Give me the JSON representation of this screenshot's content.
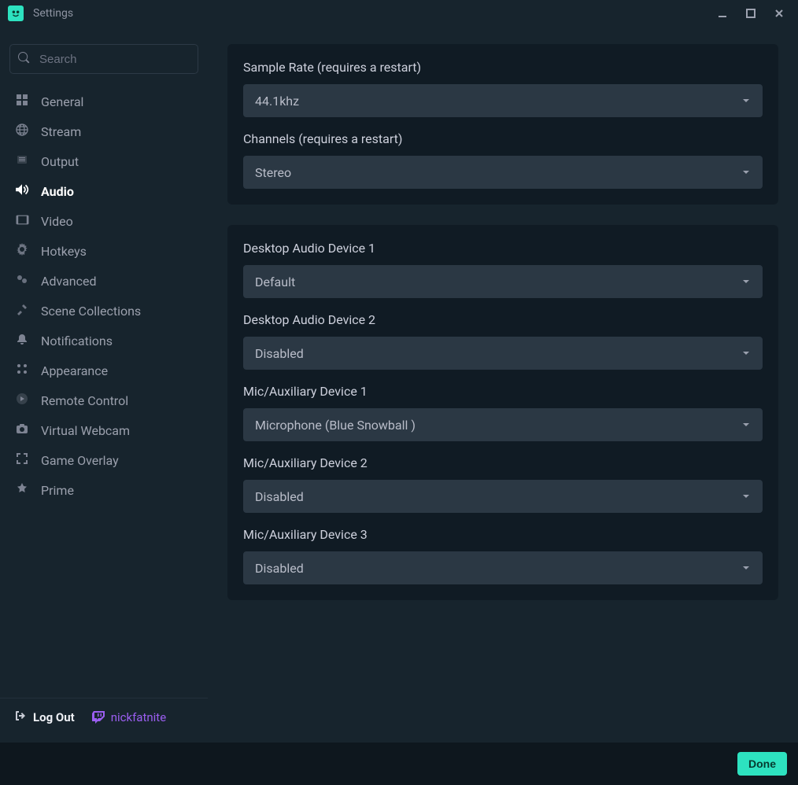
{
  "window": {
    "title": "Settings"
  },
  "sidebar": {
    "search_placeholder": "Search",
    "items": [
      {
        "icon": "⬛",
        "label": "General"
      },
      {
        "icon": "🌐",
        "label": "Stream"
      },
      {
        "icon": "▦",
        "label": "Output"
      },
      {
        "icon": "🔊",
        "label": "Audio",
        "active": true
      },
      {
        "icon": "🎞",
        "label": "Video"
      },
      {
        "icon": "⚙",
        "label": "Hotkeys"
      },
      {
        "icon": "⚙",
        "label": "Advanced"
      },
      {
        "icon": "✂",
        "label": "Scene Collections"
      },
      {
        "icon": "🔔",
        "label": "Notifications"
      },
      {
        "icon": "◯",
        "label": "Appearance"
      },
      {
        "icon": "▶",
        "label": "Remote Control"
      },
      {
        "icon": "📷",
        "label": "Virtual Webcam"
      },
      {
        "icon": "⛶",
        "label": "Game Overlay"
      },
      {
        "icon": "★",
        "label": "Prime"
      }
    ],
    "logout_label": "Log Out",
    "user": "nickfatnite"
  },
  "content": {
    "panel1": {
      "field1_label": "Sample Rate (requires a restart)",
      "field1_value": "44.1khz",
      "field2_label": "Channels (requires a restart)",
      "field2_value": "Stereo"
    },
    "panel2": {
      "f1_label": "Desktop Audio Device 1",
      "f1_value": "Default",
      "f2_label": "Desktop Audio Device 2",
      "f2_value": "Disabled",
      "f3_label": "Mic/Auxiliary Device 1",
      "f3_value": "Microphone (Blue Snowball )",
      "f4_label": "Mic/Auxiliary Device 2",
      "f4_value": "Disabled",
      "f5_label": "Mic/Auxiliary Device 3",
      "f5_value": "Disabled"
    }
  },
  "footer": {
    "done_label": "Done"
  }
}
